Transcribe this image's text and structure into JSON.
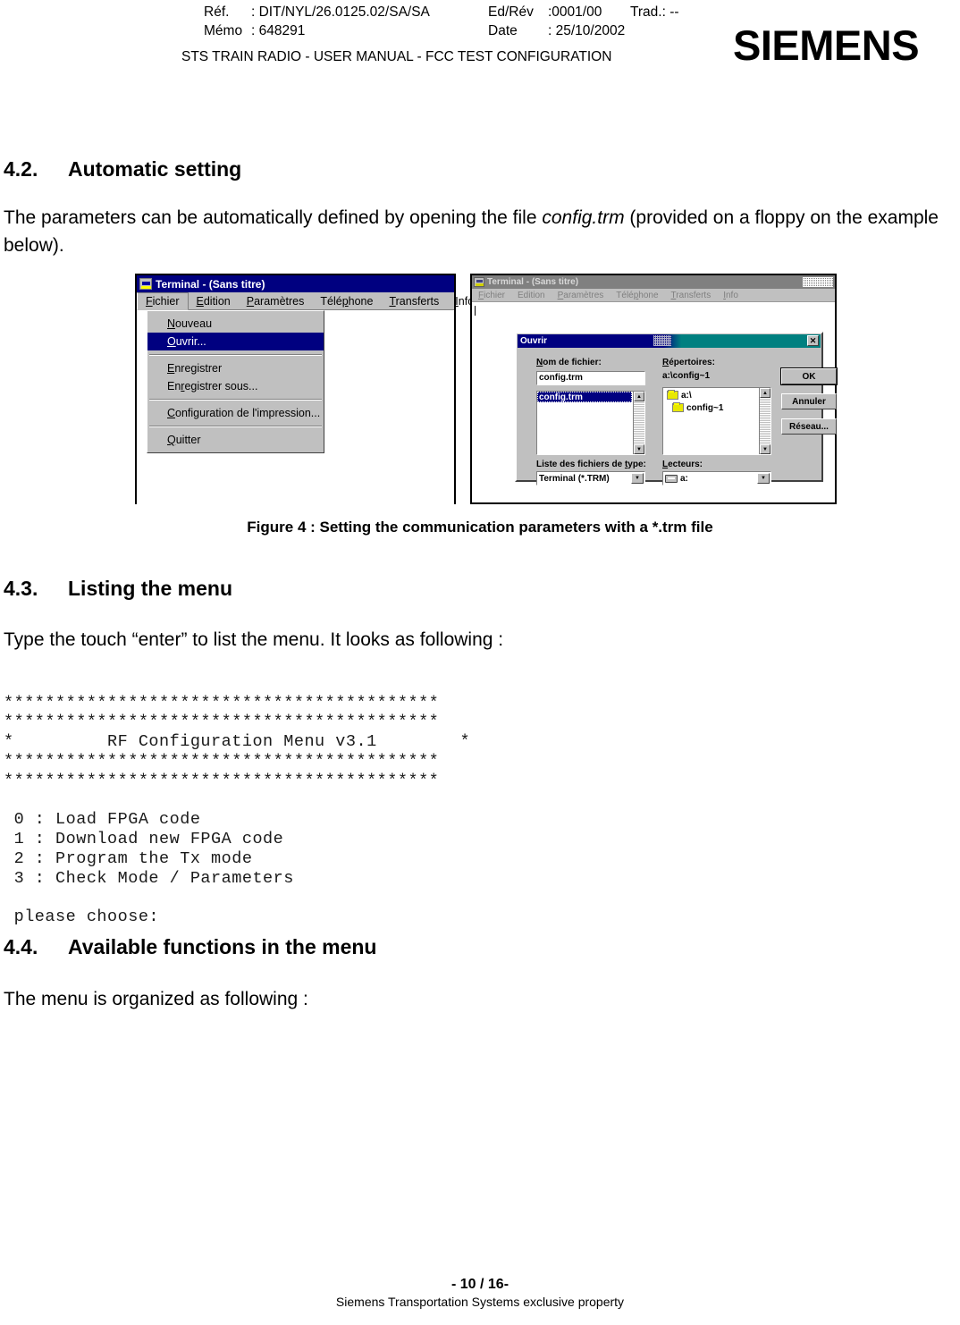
{
  "header": {
    "ref_label": "Réf.",
    "ref_value": ": DIT/NYL/26.0125.02/SA/SA",
    "memo_label": "Mémo",
    "memo_value": ": 648291",
    "edrev_label": "Ed/Rév",
    "edrev_value": ":0001/00",
    "trad": "Trad.: --",
    "date_label": "Date",
    "date_value": ": 25/10/2002",
    "doc_title": "STS TRAIN RADIO - USER MANUAL - FCC TEST CONFIGURATION",
    "logo": "SIEMENS"
  },
  "sections": {
    "s42": {
      "number": "4.2.",
      "title": "Automatic setting",
      "paragraph_part1": "The parameters can be automatically defined by opening the file ",
      "paragraph_italic": "config.trm",
      "paragraph_part2": " (provided on a floppy on the example below)."
    },
    "s43": {
      "number": "4.3.",
      "title": "Listing the menu",
      "paragraph": "Type the touch “enter” to list the menu. It looks as following :"
    },
    "s44": {
      "number": "4.4.",
      "title": "Available functions in the menu",
      "paragraph": "The menu is organized as following :"
    }
  },
  "figure_caption": "Figure 4 :  Setting the communication parameters with a *.trm file",
  "terminal_listing": {
    "lines": [
      "******************************************",
      "******************************************",
      "*         RF Configuration Menu v3.1        *",
      "******************************************",
      "******************************************",
      "",
      " 0 : Load FPGA code",
      " 1 : Download new FPGA code",
      " 2 : Program the Tx mode",
      " 3 : Check Mode / Parameters",
      "",
      " please choose:"
    ],
    "full_text": "******************************************\n******************************************\n*         RF Configuration Menu v3.1        *\n******************************************\n******************************************\n\n 0 : Load FPGA code\n 1 : Download new FPGA code\n 2 : Program the Tx mode\n 3 : Check Mode / Parameters\n\n please choose:",
    "menu_title": "RF Configuration Menu v3.1",
    "options": [
      {
        "key": "0",
        "label": "Load FPGA code"
      },
      {
        "key": "1",
        "label": "Download new FPGA code"
      },
      {
        "key": "2",
        "label": "Program the Tx mode"
      },
      {
        "key": "3",
        "label": "Check Mode / Parameters"
      }
    ],
    "prompt": "please choose:"
  },
  "screenshot_left": {
    "window_title": "Terminal - (Sans titre)",
    "menubar": [
      {
        "label": "Fichier",
        "mnemonic": "F"
      },
      {
        "label": "Edition",
        "mnemonic": "E"
      },
      {
        "label": "Paramètres",
        "mnemonic": "P"
      },
      {
        "label": "Téléphone",
        "mnemonic": "p"
      },
      {
        "label": "Transferts",
        "mnemonic": "T"
      },
      {
        "label": "Info",
        "mnemonic": "I"
      }
    ],
    "dropdown": [
      {
        "label": "Nouveau",
        "selected": false
      },
      {
        "label": "Ouvrir...",
        "selected": true
      },
      {
        "separator": true
      },
      {
        "label": "Enregistrer",
        "selected": false
      },
      {
        "label": "Enregistrer sous...",
        "selected": false
      },
      {
        "separator": true
      },
      {
        "label": "Configuration de l'impression...",
        "selected": false
      },
      {
        "separator": true
      },
      {
        "label": "Quitter",
        "selected": false
      }
    ]
  },
  "screenshot_right": {
    "window_title": "Terminal - (Sans titre)",
    "menubar": [
      {
        "label": "Fichier"
      },
      {
        "label": "Edition"
      },
      {
        "label": "Paramètres"
      },
      {
        "label": "Téléphone"
      },
      {
        "label": "Transferts"
      },
      {
        "label": "Info"
      }
    ],
    "dialog": {
      "title": "Ouvrir",
      "close_label": "✕",
      "filename_label": "Nom de fichier:",
      "filename_value": "config.trm",
      "file_list": [
        "config.trm"
      ],
      "directories_label": "Répertoires:",
      "current_path": "a:\\config~1",
      "directory_tree": [
        {
          "label": "a:\\",
          "icon": "folder-open-icon"
        },
        {
          "label": "config~1",
          "icon": "folder-open-icon"
        }
      ],
      "filetype_label": "Liste des fichiers de type:",
      "filetype_value": "Terminal (*.TRM)",
      "drives_label": "Lecteurs:",
      "drives_value": "a:",
      "buttons": [
        {
          "label": "OK",
          "default": true
        },
        {
          "label": "Annuler",
          "default": false
        },
        {
          "label": "Réseau...",
          "default": false
        }
      ]
    }
  },
  "footer": {
    "page": "- 10 / 16-",
    "note": "Siemens Transportation Systems exclusive property"
  }
}
